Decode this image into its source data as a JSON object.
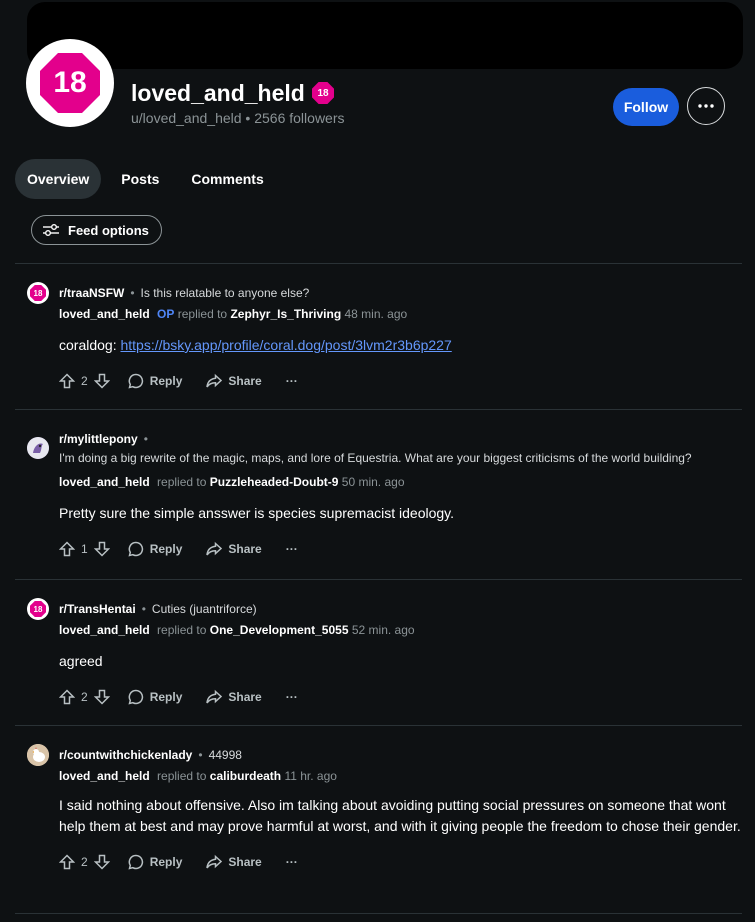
{
  "profile": {
    "avatar_text": "18",
    "badge_text": "18",
    "username": "loved_and_held",
    "handle_line": "u/loved_and_held • 2566 followers",
    "follow_label": "Follow",
    "more_label": "•••"
  },
  "tabs": [
    "Overview",
    "Posts",
    "Comments"
  ],
  "feed_options_label": "Feed options",
  "posts": [
    {
      "subreddit": "r/traaNSFW",
      "title": "Is this relatable to anyone else?",
      "author": "loved_and_held",
      "op": "OP",
      "replied_to_label": "replied to",
      "replied_to": "Zephyr_Is_Thriving",
      "time": "48 min. ago",
      "body_prefix": "coraldog: ",
      "body_link": "https://bsky.app/profile/coral.dog/post/3lvm2r3b6p227",
      "body": "",
      "votes": "2",
      "icon": "nsfw-18"
    },
    {
      "subreddit": "r/mylittlepony",
      "title": "I'm doing a big rewrite of the magic, maps, and lore of Equestria. What are your biggest criticisms of the world building?",
      "author": "loved_and_held",
      "replied_to_label": "replied to",
      "replied_to": "Puzzleheaded-Doubt-9",
      "time": "50 min. ago",
      "body": "Pretty sure the simple ansswer is species supremacist ideology.",
      "votes": "1",
      "icon": "pony"
    },
    {
      "subreddit": "r/TransHentai",
      "title": "Cuties (juantriforce)",
      "author": "loved_and_held",
      "replied_to_label": "replied to",
      "replied_to": "One_Development_5055",
      "time": "52 min. ago",
      "body": "agreed",
      "votes": "2",
      "icon": "nsfw-18"
    },
    {
      "subreddit": "r/countwithchickenlady",
      "title": "44998",
      "author": "loved_and_held",
      "replied_to_label": "replied to",
      "replied_to": "caliburdeath",
      "time": "11 hr. ago",
      "body": "I said nothing about offensive. Also im talking about avoiding putting social pressures on someone that wont help them at best and may prove harmful at worst, and with it giving people the freedom to chose their gender.",
      "votes": "2",
      "icon": "chicken"
    }
  ],
  "actions": {
    "reply": "Reply",
    "share": "Share",
    "more": "···"
  },
  "colors": {
    "accent": "#1a5ddd",
    "nsfw": "#e3008c",
    "link": "#6497fb",
    "op": "#4f86f7",
    "background": "#0e1113"
  }
}
